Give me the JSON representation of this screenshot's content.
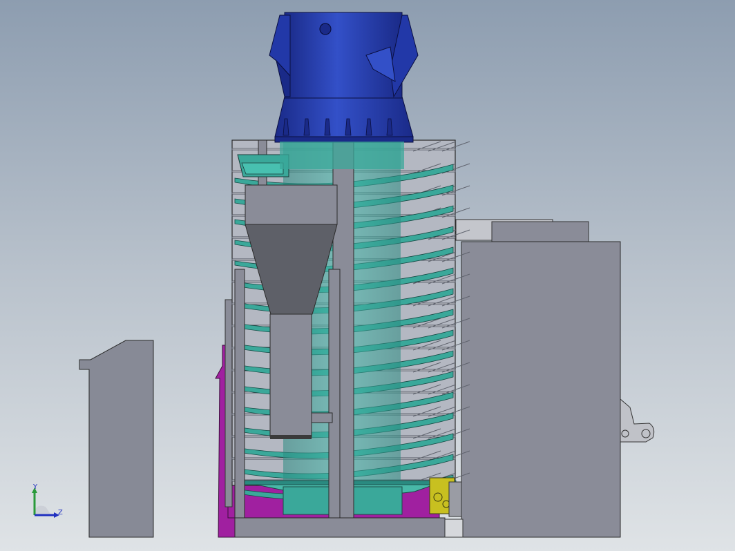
{
  "view": {
    "background_top": "#8d9db0",
    "background_bottom": "#dfe3e6"
  },
  "triad": {
    "y_label": "Y",
    "z_label": "Z",
    "y_color": "#2a9a3a",
    "z_color": "#2030c0"
  },
  "colors": {
    "motor_blue": "#2a3fa8",
    "helix_teal": "#3aa89a",
    "frame_gray": "#8a8c98",
    "hopper_dark": "#5e6068",
    "magenta_frame": "#a020a0",
    "yellow_part": "#c8c020"
  }
}
